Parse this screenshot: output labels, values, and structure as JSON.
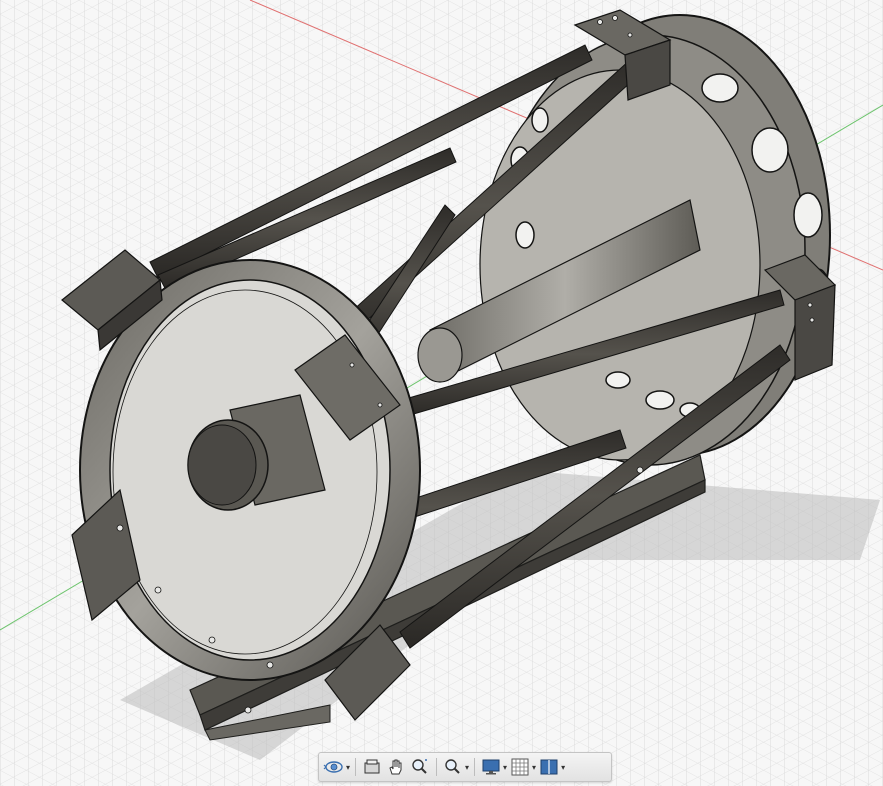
{
  "viewport": {
    "model": "telescope-truss-assembly",
    "background_color": "#f7f7f7",
    "grid_color": "#d2d2d2",
    "x_axis_color": "#e05050",
    "y_axis_color": "#48b848",
    "body_color": "#4a4a46",
    "tube_color": "#3c3a36",
    "metal_color": "#8c8a84"
  },
  "navigation_toolbar": {
    "tools": [
      {
        "icon": "orbit-icon",
        "has_dropdown": true
      },
      {
        "icon": "look-at-icon",
        "has_dropdown": false
      },
      {
        "icon": "pan-hand-icon",
        "has_dropdown": false
      },
      {
        "icon": "zoom-icon",
        "has_dropdown": false
      },
      {
        "icon": "zoom-window-icon",
        "has_dropdown": true
      },
      {
        "icon": "display-settings-icon",
        "has_dropdown": true
      },
      {
        "icon": "grid-snaps-icon",
        "has_dropdown": true
      },
      {
        "icon": "viewports-icon",
        "has_dropdown": true
      }
    ],
    "dropdown_glyph": "▾"
  }
}
